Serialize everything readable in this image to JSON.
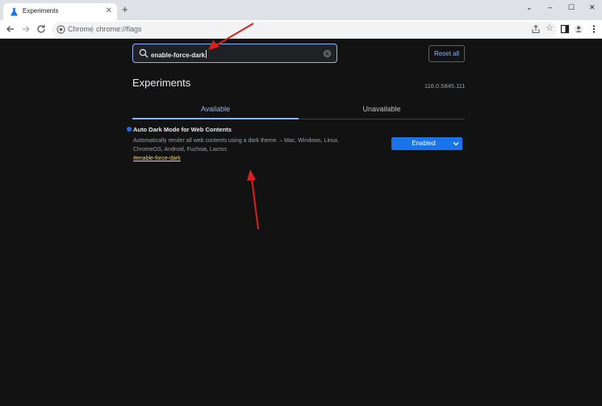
{
  "browser": {
    "tab_title": "Experiments",
    "tab_close": "✕",
    "new_tab": "+",
    "window_controls": {
      "minimize": "–",
      "maximize": "☐",
      "close": "✕",
      "dropdown": "⌄"
    },
    "omnibox": {
      "chip": "Chrome",
      "url": "chrome://flags"
    },
    "bookmark_star": "☆"
  },
  "page": {
    "search": {
      "value": "enable-force-dark"
    },
    "reset_label": "Reset all",
    "heading": "Experiments",
    "version": "116.0.5845.111",
    "tabs": {
      "available": "Available",
      "unavailable": "Unavailable"
    },
    "flag": {
      "title": "Auto Dark Mode for Web Contents",
      "description": "Automatically render all web contents using a dark theme. – Mac, Windows, Linux, ChromeOS, Android, Fuchsia, Lacros",
      "link": "#enable-force-dark",
      "selected": "Enabled"
    }
  },
  "colors": {
    "page_bg": "#121212",
    "accent": "#8ab4f8",
    "select_bg": "#1a73e8",
    "link": "#fdd663",
    "annotation": "#e01e1e"
  }
}
